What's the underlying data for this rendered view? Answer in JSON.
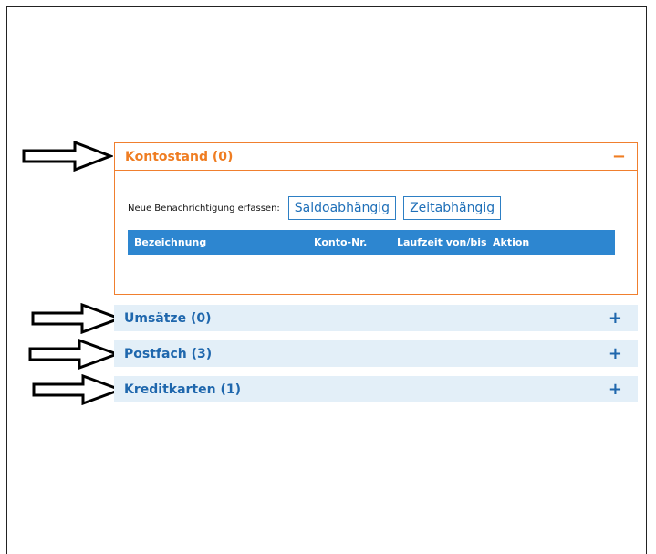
{
  "sections": {
    "kontostand": {
      "title": "Kontostand (0)",
      "toggle": "−",
      "notify_label": "Neue Benachrichtigung erfassen:",
      "buttons": [
        "Saldoabhängig",
        "Zeitabhängig"
      ],
      "table_headers": [
        "Bezeichnung",
        "Konto-Nr.",
        "Laufzeit von/bis",
        "Aktion"
      ]
    },
    "umsaetze": {
      "title": "Umsätze (0)",
      "toggle": "+"
    },
    "postfach": {
      "title": "Postfach (3)",
      "toggle": "+"
    },
    "kreditkarten": {
      "title": "Kreditkarten (1)",
      "toggle": "+"
    }
  },
  "colors": {
    "accent_orange": "#ef7d22",
    "accent_blue": "#1f67ad",
    "table_header_bg": "#2d86d0",
    "closed_panel_bg": "#e3eff8"
  },
  "icons": [
    "arrow-right-icon",
    "minus-icon",
    "plus-icon"
  ]
}
